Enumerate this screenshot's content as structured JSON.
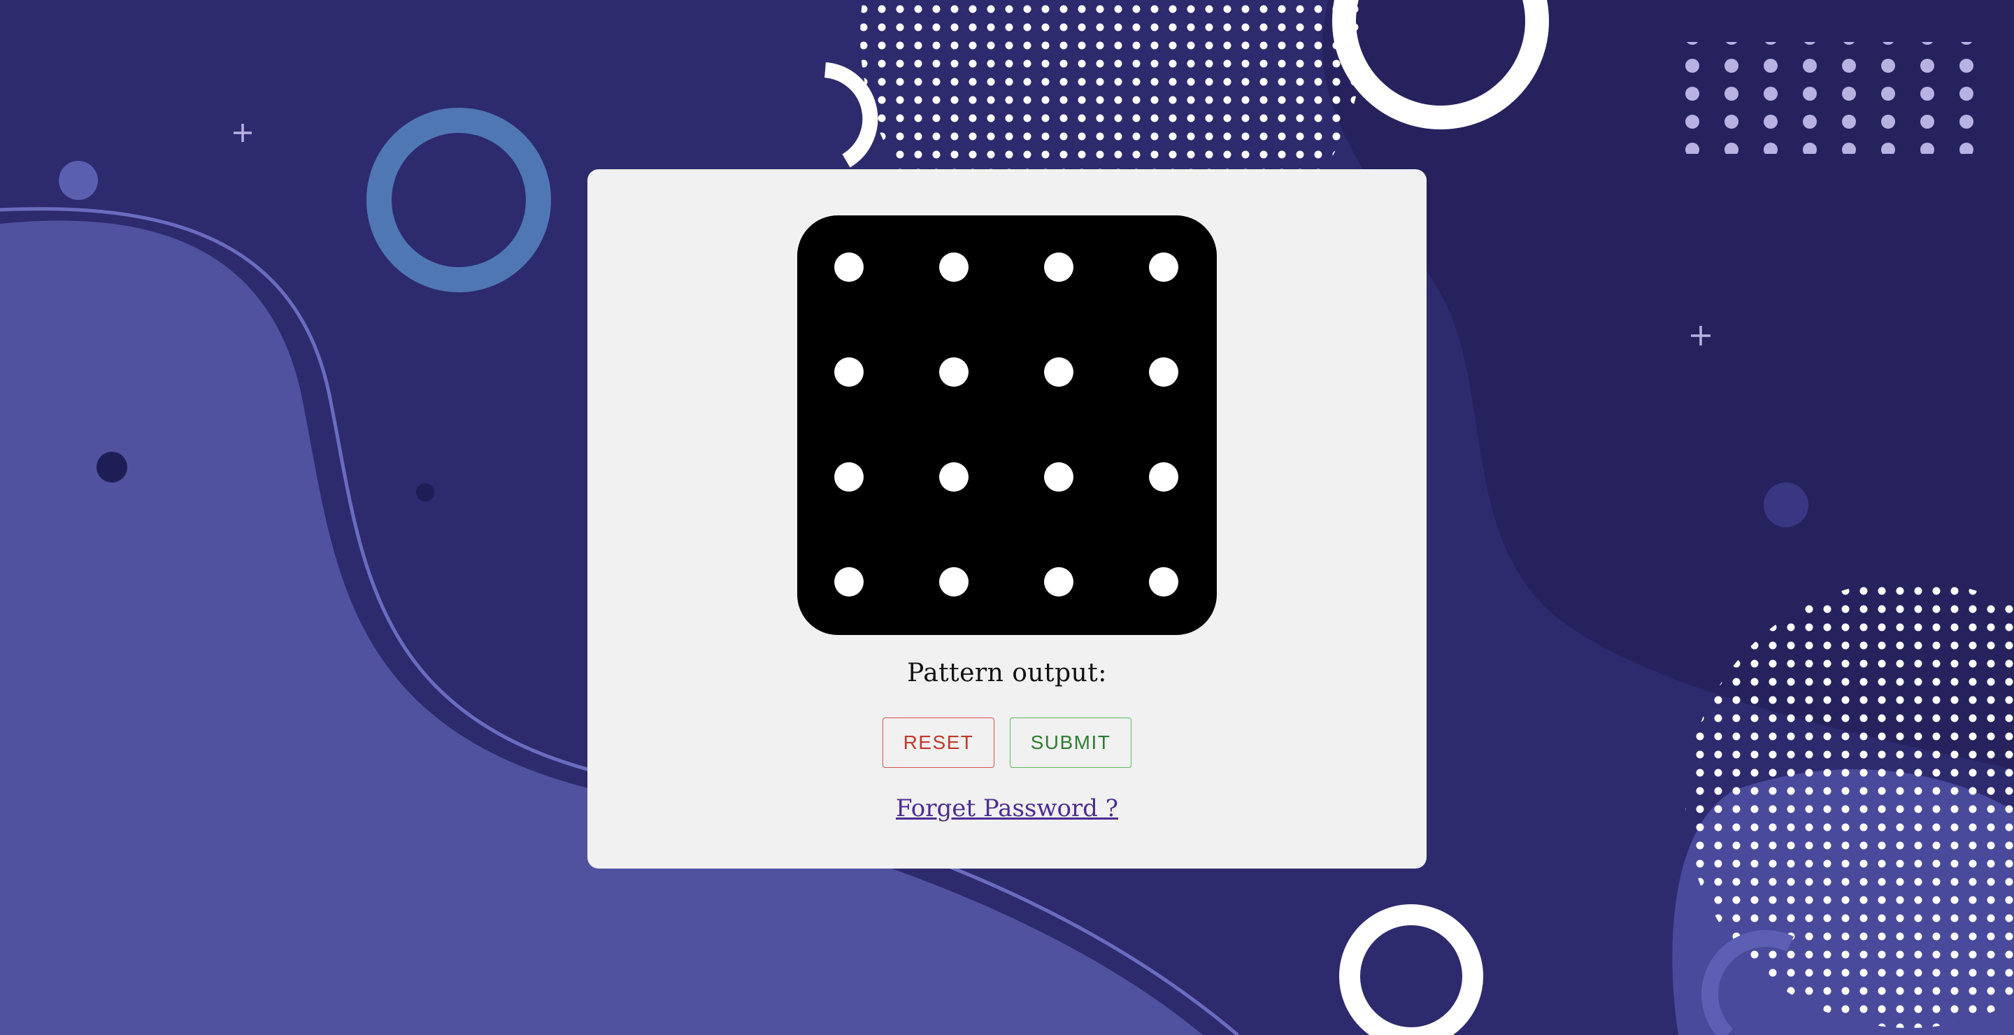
{
  "pattern_lock": {
    "rows": 4,
    "columns": 4,
    "output_label": "Pattern output:"
  },
  "buttons": {
    "reset_label": "RESET",
    "submit_label": "SUBMIT"
  },
  "links": {
    "forget_password": "Forget Password ?"
  },
  "colors": {
    "background": "#2d2a6e",
    "blob_light": "#5052a0",
    "card": "#f1f1f1",
    "pad": "#000000",
    "reset": "#c0392b",
    "submit": "#2e7d32",
    "link": "#4b2c91"
  }
}
